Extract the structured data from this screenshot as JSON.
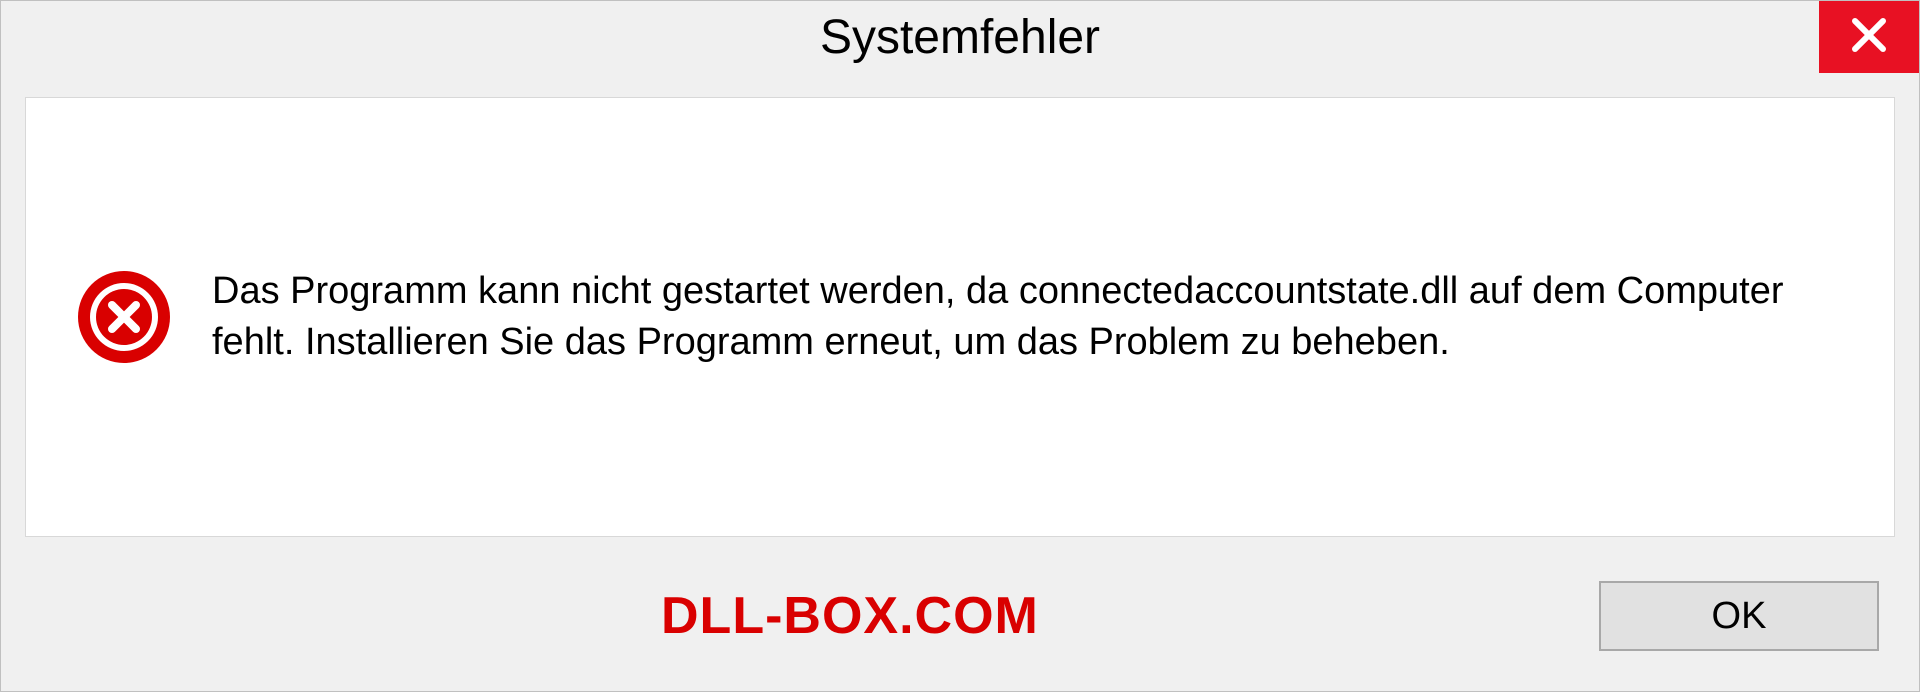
{
  "dialog": {
    "title": "Systemfehler",
    "message": "Das Programm kann nicht gestartet werden, da connectedaccountstate.dll auf dem Computer fehlt. Installieren Sie das Programm erneut, um das Problem zu beheben.",
    "ok_label": "OK"
  },
  "watermark": "DLL-BOX.COM"
}
